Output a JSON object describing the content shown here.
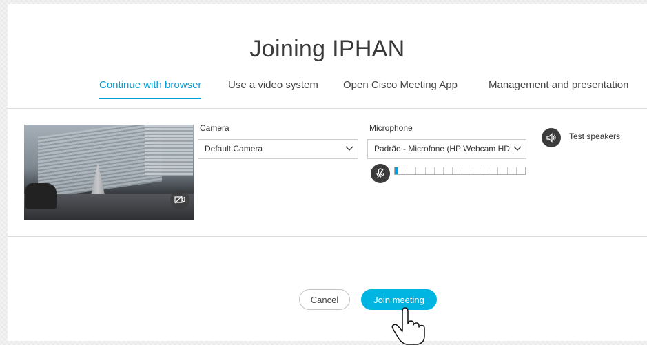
{
  "page": {
    "title": "Joining IPHAN"
  },
  "tabs": [
    {
      "label": "Continue with browser",
      "active": true
    },
    {
      "label": "Use a video system",
      "active": false
    },
    {
      "label": "Open Cisco Meeting App",
      "active": false
    },
    {
      "label": "Management and presentation",
      "active": false
    }
  ],
  "camera": {
    "label": "Camera",
    "selected": "Default Camera",
    "preview_icon": "camera-off-icon"
  },
  "microphone": {
    "label": "Microphone",
    "selected": "Padrão - Microfone (HP Webcam HD",
    "mute_icon": "microphone-muted-icon",
    "level": 0.02
  },
  "speakers": {
    "label": "Test speakers",
    "icon": "speaker-icon"
  },
  "actions": {
    "cancel_label": "Cancel",
    "join_label": "Join meeting"
  },
  "colors": {
    "accent": "#049fd9",
    "join_button": "#00b5e2",
    "icon_bg": "#3b3b3b"
  },
  "cursor": {
    "type": "hand-pointer"
  }
}
